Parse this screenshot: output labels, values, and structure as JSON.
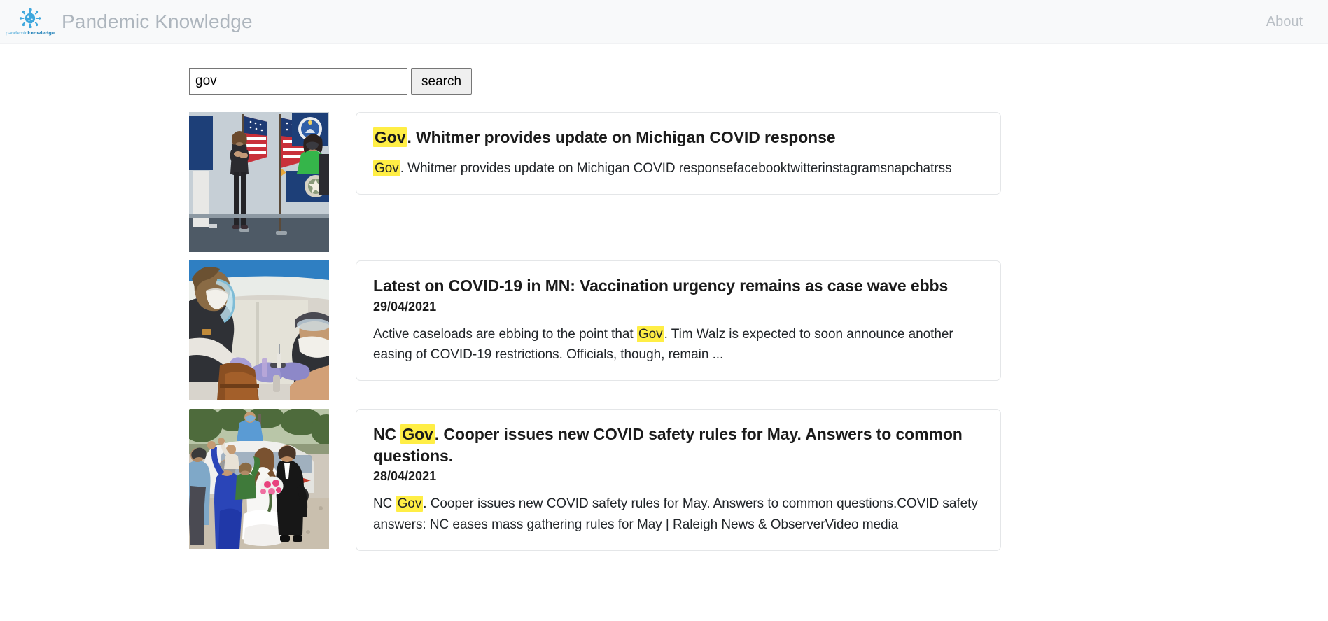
{
  "navbar": {
    "brand_title": "Pandemic Knowledge",
    "logo_word_1": "pandemic",
    "logo_word_2": "knowledge",
    "logo_icon": "virus-icon",
    "about_label": "About"
  },
  "search": {
    "value": "gov",
    "placeholder": "",
    "button_label": "search",
    "query": "gov"
  },
  "colors": {
    "highlight": "#ffee45",
    "brand_text": "#adb5bd",
    "logo_blue": "#2f89bd",
    "card_border": "#e4e6e8",
    "navbar_bg": "#f8f9fa"
  },
  "results": [
    {
      "thumb_name": "press-conference-photo",
      "title_parts": [
        {
          "text": "Gov",
          "highlight": true
        },
        {
          "text": ". Whitmer provides update on Michigan COVID response",
          "highlight": false
        }
      ],
      "date": "",
      "snippet_parts": [
        {
          "text": "Gov",
          "highlight": true
        },
        {
          "text": ". Whitmer provides update on Michigan COVID responsefacebooktwitterinstagramsnapchatrss",
          "highlight": false
        }
      ]
    },
    {
      "thumb_name": "vaccination-photo",
      "title_parts": [
        {
          "text": "Latest on COVID-19 in MN: Vaccination urgency remains as case wave ebbs",
          "highlight": false
        }
      ],
      "date": "29/04/2021",
      "snippet_parts": [
        {
          "text": "Active caseloads are ebbing to the point that ",
          "highlight": false
        },
        {
          "text": "Gov",
          "highlight": true
        },
        {
          "text": ". Tim Walz is expected to soon announce another easing of COVID-19 restrictions. Officials, though, remain ...",
          "highlight": false
        }
      ]
    },
    {
      "thumb_name": "wedding-photo",
      "title_parts": [
        {
          "text": "NC ",
          "highlight": false
        },
        {
          "text": "Gov",
          "highlight": true
        },
        {
          "text": ". Cooper issues new COVID safety rules for May. Answers to common questions.",
          "highlight": false
        }
      ],
      "date": "28/04/2021",
      "snippet_parts": [
        {
          "text": "NC ",
          "highlight": false
        },
        {
          "text": "Gov",
          "highlight": true
        },
        {
          "text": ". Cooper issues new COVID safety rules for May. Answers to common questions.COVID safety answers: NC eases mass gathering rules for May | Raleigh News & ObserverVideo media",
          "highlight": false
        }
      ]
    }
  ]
}
